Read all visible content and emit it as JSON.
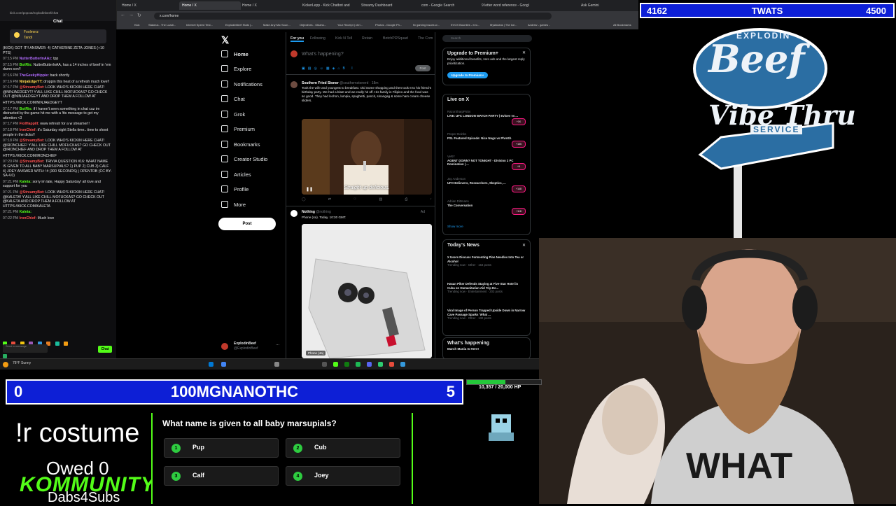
{
  "browser": {
    "tabs": [
      "Home / X",
      "Home / X",
      "Home / X",
      "KickerLepp - Kick Chatbot and",
      "Streamy Dashboard",
      "com - Google Search",
      "9 letter word reference - Googl",
      "Ask Gemini"
    ],
    "url": "x.com/home",
    "bookmarks": [
      "Kick",
      "Stakeus - The Loadi...",
      "Internet Speed Test...",
      "ExplodinBeef Stats |...",
      "Make Any Mic Soun...",
      "Objectives - Oklaho...",
      "Your Receipt | chri...",
      "Photos - Google Ph...",
      "fix gaming issues w...",
      "EVOX Bounties - evo...",
      "Mysticians | The Ice...",
      "Andrew - games -",
      "All Bookmarks"
    ]
  },
  "chat": {
    "url": "kick.com/popout/explodinbeef/chat",
    "title": "Chat",
    "pinned": [
      "Foolmerz",
      "Tandi",
      "TheCrazyChicken"
    ],
    "messages": [
      {
        "time": "",
        "user": "",
        "cls": "",
        "text": "(KICK) GOT IT!! ANSWER: 4) CATHERINE ZETA-JONES (+10 PTS)"
      },
      {
        "time": "07:15 PM",
        "user": "NutterButterInAAz:",
        "cls": "p",
        "text": "tpp"
      },
      {
        "time": "07:15 PM",
        "user": "BotRix:",
        "cls": "",
        "text": "NutterButterInAA, has a 14 inches of beef in 'em damn son!!"
      },
      {
        "time": "07:16 PM",
        "user": "TheGeekyHippie:",
        "cls": "p",
        "text": "back shortly"
      },
      {
        "time": "07:16 PM",
        "user": "NinjaEdgeYT:",
        "cls": "y",
        "text": "droppin this heat of a refresh much love!!"
      },
      {
        "time": "07:17 PM",
        "user": "@StreamyBot:",
        "cls": "r",
        "text": "LOOK WHO'S KICKIN HERE CHAT! @NINJAEDGEYT! Y'ALL LIKE CHILL MOFUCKAS? GO CHECK OUT @NINJAEDGEYT AND DROP THEM A FOLLOW AT"
      },
      {
        "time": "",
        "user": "",
        "cls": "",
        "text": "HTTPS://KICK.COM/NINJAEDGEYT"
      },
      {
        "time": "07:17 PM",
        "user": "BotRix:",
        "cls": "",
        "text": "if I haven't seen something in chat cuz im distracted by the game hit me with a !tts message to get my attention <3"
      },
      {
        "time": "07:17 PM",
        "user": "FiolHappill:",
        "cls": "r",
        "text": "www refresh for a w streamer!!"
      },
      {
        "time": "07:18 PM",
        "user": "IronChief:",
        "cls": "r",
        "text": "it's Saturday night Stella time.. time to shoot people in the dicks!!"
      },
      {
        "time": "07:18 PM",
        "user": "@StreamyBot:",
        "cls": "r",
        "text": "LOOK WHO'S KICKIN HERE CHAT! @IRONCHIEF! Y'ALL LIKE CHILL MOFUCKAS? GO CHECK OUT @IRONCHIEF AND DROP THEM A FOLLOW AT"
      },
      {
        "time": "",
        "user": "",
        "cls": "",
        "text": "HTTPS://KICK.COM/IRONCHIEF"
      },
      {
        "time": "07:20 PM",
        "user": "@StreamyBot:",
        "cls": "r",
        "text": "TRIVIA QUESTION #16: WHAT NAME IS GIVEN TO ALL BABY MARSUPIALS? 1) PUP 2) CUB 3) CALF 4) JOEY ANSWER WITH: !# (300 SECONDS) | OPENTDB (CC BY-SA 4.0)"
      },
      {
        "time": "07:21 PM",
        "user": "Kaleta:",
        "cls": "",
        "text": "sorry im late, Happy Saturday! all love and support for you"
      },
      {
        "time": "07:21 PM",
        "user": "@StreamyBot:",
        "cls": "r",
        "text": "LOOK WHO'S KICKIN HERE CHAT! @KALETA! Y'ALL LIKE CHILL MOFUCKAS? GO CHECK OUT @KALETA AND DROP THEM A FOLLOW AT HTTPS://KICK.COM/KALETA"
      },
      {
        "time": "07:21 PM",
        "user": "Kaleta:",
        "cls": "",
        "text": ""
      },
      {
        "time": "07:22 PM",
        "user": "IronChief:",
        "cls": "r",
        "text": "Much love"
      }
    ],
    "input_placeholder": "Send a message",
    "send_label": "Chat"
  },
  "x": {
    "nav": [
      "Home",
      "Explore",
      "Notifications",
      "Chat",
      "Grok",
      "Premium",
      "Bookmarks",
      "Creator Studio",
      "Articles",
      "Profile",
      "More"
    ],
    "post_button": "Post",
    "profile_name": "ExplodinBeef",
    "profile_handle": "@ExplodinBeef",
    "feed_tabs": [
      "For you",
      "Following",
      "Kick N Tell",
      "Retain",
      "BotchPl2Squad",
      "The Com"
    ],
    "compose_placeholder": "What's happening?",
    "compose_post": "Post",
    "tweet1": {
      "author": "Southern Fried Stoner",
      "handle": "@southernstonerd · 18m",
      "text": "Took the wife and youngest to breakfast. Old Some shopping and then took 8 to his friend's birthday party. We had a blast and we really hit off. His family is Filipino and the food was so good. They had lechon, lumpia, spaghetti, pancit, sinangag & some ham cream cheese sliders.",
      "caption": "Straight up delicious."
    },
    "tweet2": {
      "author": "Nothing",
      "handle": "@nothing",
      "text": "Phone (4a). Today. 10:30 GMT.",
      "media_label": "Phone (4a)",
      "ad": "Ad"
    },
    "search_placeholder": "Search",
    "premium": {
      "title": "Upgrade to Premium+",
      "text": "Enjoy additional benefits, zero ads and the largest reply prioritization.",
      "button": "Upgrade to Premium+"
    },
    "live": {
      "title": "Live on X",
      "items": [
        {
          "host": "RazorSharpPicks",
          "text": "LIVE: UFC LONDON WATCH PARTY | Evloev vs ...",
          "badge": "+1K"
        },
        {
          "host": "Proper Doinks",
          "text": "PSL Featured Episode: Nice Nugs vs PhreSh",
          "badge": "+155"
        },
        {
          "host": "VeRY",
          "text": "AGENT DOWN? NOT TONIGHT - Division 2 PC Domination | ...",
          "badge": "+9"
        },
        {
          "host": "Jay Anderson",
          "text": "UFO Believers, Researchers, Skeptics, ...",
          "badge": "+148"
        },
        {
          "host": "Adrian Dittmann",
          "text": "The Conversation",
          "badge": "+118"
        }
      ],
      "show_more": "Show more"
    },
    "news": {
      "title": "Today's News",
      "items": [
        {
          "headline": "X Users Discuss Fermenting Pine Needles Into Tea or Alcohol",
          "meta": "Trending now · Other · 164 posts"
        },
        {
          "headline": "Hasan Piker Defends Staying at Five-Star Hotel in Cuba on Humanitarian Aid Trip De...",
          "meta": "Trending now · Entertainment · 203 posts"
        },
        {
          "headline": "Viral Image of Person Trapped Upside Down in Narrow Cave Passage Sparks 'What ...",
          "meta": "Trending now · Other · 132 posts"
        }
      ]
    },
    "happening": {
      "title": "What's happening",
      "item": "March Mania Is Here!"
    }
  },
  "taskbar": {
    "weather": "78°F Sunny",
    "time": "7:23 PM",
    "date": "3/21/2026"
  },
  "overlay": {
    "top_left": "4162",
    "top_name": "TWATS",
    "top_right": "4500",
    "logo_line1": "EXPLODIN",
    "logo_line2": "Beef",
    "logo_line3": "Vibe Thru",
    "logo_line4": "SERVICE",
    "bottom_left": "0",
    "bottom_name": "100MGNANOTHC",
    "bottom_right": "5",
    "hp_text": "10,357 / 20,000 HP",
    "hp_fraction": 0.52,
    "costume": "!r costume",
    "owed": "Owed 0",
    "community": "KOMMUNITY",
    "dabs": "Dabs4Subs",
    "shirt_text": "WHAT",
    "trivia": {
      "question": "What name is given to all baby marsupials?",
      "answers": [
        {
          "num": "1",
          "label": "Pup"
        },
        {
          "num": "2",
          "label": "Cub"
        },
        {
          "num": "3",
          "label": "Calf"
        },
        {
          "num": "4",
          "label": "Joey"
        }
      ]
    },
    "colors": {
      "blue": "#0d1fd6",
      "kick_green": "#53fc18",
      "answer_green": "#2ecc40"
    }
  }
}
